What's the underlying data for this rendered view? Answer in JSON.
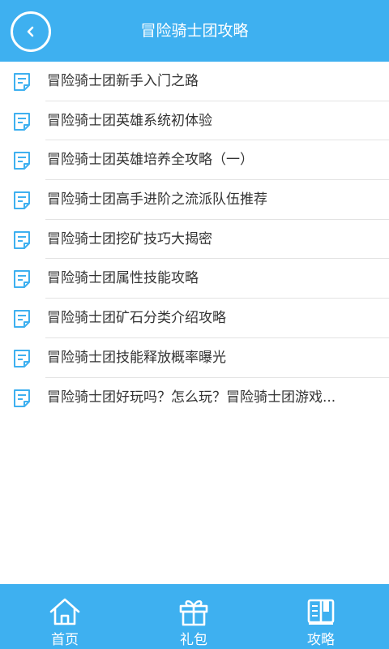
{
  "header": {
    "title": "冒险骑士团攻略"
  },
  "list": {
    "items": [
      {
        "label": "冒险骑士团新手入门之路"
      },
      {
        "label": "冒险骑士团英雄系统初体验"
      },
      {
        "label": "冒险骑士团英雄培养全攻略（一）"
      },
      {
        "label": "冒险骑士团高手进阶之流派队伍推荐"
      },
      {
        "label": "冒险骑士团挖矿技巧大揭密"
      },
      {
        "label": "冒险骑士团属性技能攻略"
      },
      {
        "label": "冒险骑士团矿石分类介绍攻略"
      },
      {
        "label": "冒险骑士团技能释放概率曝光"
      },
      {
        "label": "冒险骑士团好玩吗？怎么玩？冒险骑士团游戏..."
      }
    ]
  },
  "tabbar": {
    "tabs": [
      {
        "label": "首页",
        "icon": "home-icon"
      },
      {
        "label": "礼包",
        "icon": "gift-icon"
      },
      {
        "label": "攻略",
        "icon": "book-icon"
      }
    ]
  },
  "colors": {
    "primary": "#3eb0f0",
    "text": "#333333",
    "divider": "#e3e3e3",
    "white": "#ffffff"
  }
}
